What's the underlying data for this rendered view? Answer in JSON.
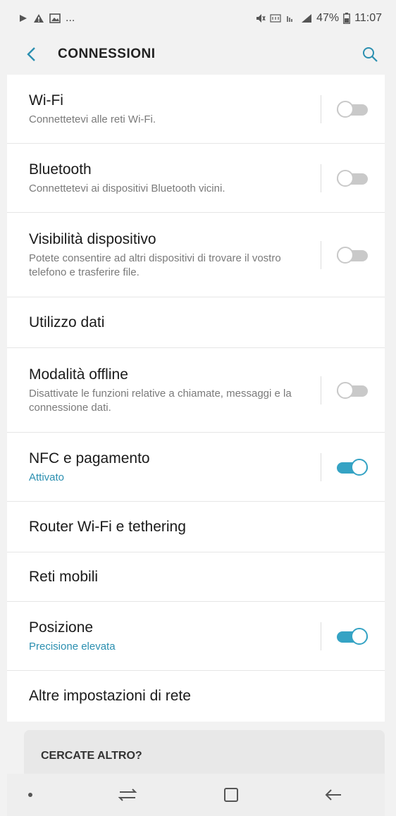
{
  "statusbar": {
    "battery": "47%",
    "time": "11:07",
    "left_icons": [
      "play-notification-icon",
      "warning-icon",
      "image-icon",
      "more-dots"
    ],
    "more_dots": "..."
  },
  "appbar": {
    "title": "CONNESSIONI"
  },
  "settings": [
    {
      "label": "Wi-Fi",
      "sub": "Connettetevi alle reti Wi-Fi.",
      "toggle": false
    },
    {
      "label": "Bluetooth",
      "sub": "Connettetevi ai dispositivi Bluetooth vicini.",
      "toggle": false
    },
    {
      "label": "Visibilità dispositivo",
      "sub": "Potete consentire ad altri dispositivi di trovare il vostro telefono e trasferire file.",
      "toggle": false
    },
    {
      "label": "Utilizzo dati"
    },
    {
      "label": "Modalità offline",
      "sub": "Disattivate le funzioni relative a chiamate, messaggi e la connessione dati.",
      "toggle": false
    },
    {
      "label": "NFC e pagamento",
      "sub": "Attivato",
      "toggle": true
    },
    {
      "label": "Router Wi-Fi e tethering"
    },
    {
      "label": "Reti mobili"
    },
    {
      "label": "Posizione",
      "sub": "Precisione elevata",
      "toggle": true
    },
    {
      "label": "Altre impostazioni di rete"
    }
  ],
  "more_section": {
    "title": "CERCATE ALTRO?"
  },
  "colors": {
    "accent": "#35a3c4",
    "toggle_off": "#c9c9c9"
  }
}
